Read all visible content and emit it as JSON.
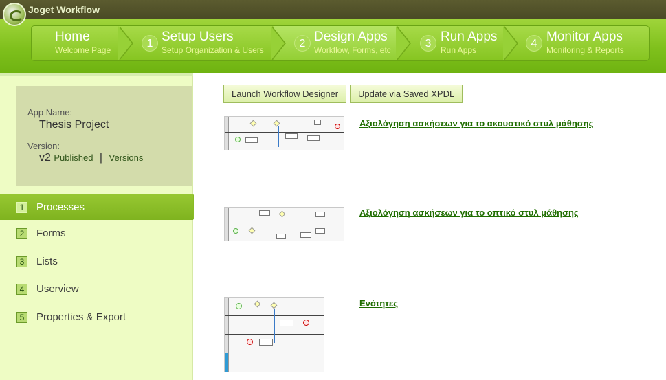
{
  "brand": "Joget Workflow",
  "nav": {
    "steps": [
      {
        "num": "",
        "title": "Home",
        "sub": "Welcome Page"
      },
      {
        "num": "1",
        "title": "Setup Users",
        "sub": "Setup Organization & Users"
      },
      {
        "num": "2",
        "title": "Design Apps",
        "sub": "Workflow, Forms, etc"
      },
      {
        "num": "3",
        "title": "Run Apps",
        "sub": "Run Apps"
      },
      {
        "num": "4",
        "title": "Monitor Apps",
        "sub": "Monitoring & Reports"
      }
    ]
  },
  "app": {
    "name_label": "App Name:",
    "name": "Thesis Project",
    "version_label": "Version:",
    "version": "v2",
    "published": "Published",
    "sep": "|",
    "versions": "Versions"
  },
  "menu": [
    {
      "num": "1",
      "label": "Processes",
      "active": true
    },
    {
      "num": "2",
      "label": "Forms"
    },
    {
      "num": "3",
      "label": "Lists"
    },
    {
      "num": "4",
      "label": "Userview"
    },
    {
      "num": "5",
      "label": "Properties & Export"
    }
  ],
  "toolbar": {
    "launch": "Launch Workflow Designer",
    "update": "Update via Saved XPDL"
  },
  "processes": [
    {
      "title": "Αξιολόγηση ασκήσεων για το ακουστικό στυλ μάθησης"
    },
    {
      "title": "Αξιολόγηση ασκήσεων για το οπτικό στυλ μάθησης"
    },
    {
      "title": "Ενότητες"
    }
  ]
}
